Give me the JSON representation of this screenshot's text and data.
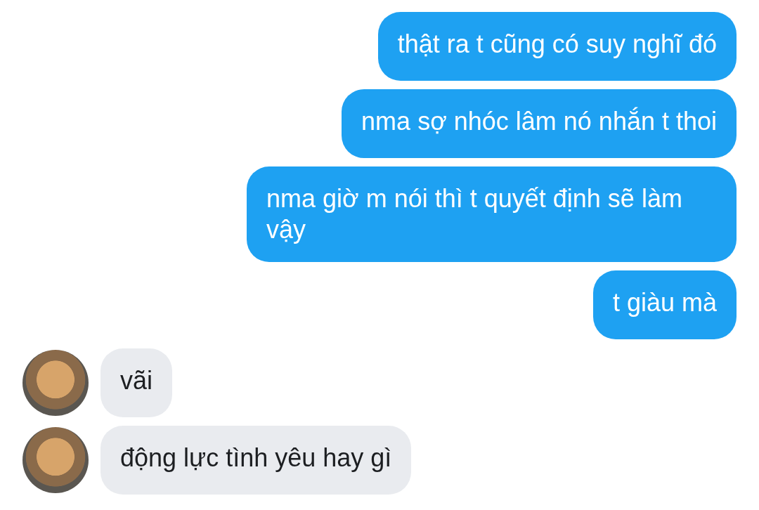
{
  "messages": [
    {
      "kind": "sent",
      "text": "thật ra t cũng có suy nghĩ đó"
    },
    {
      "kind": "sent",
      "text": "nma sợ nhóc lâm nó nhắn t thoi"
    },
    {
      "kind": "sent",
      "text": "nma giờ m nói thì t quyết định sẽ làm vậy"
    },
    {
      "kind": "sent",
      "text": "t giàu mà"
    },
    {
      "kind": "received",
      "text": "vãi"
    },
    {
      "kind": "received",
      "text": "động lực tình yêu hay gì"
    }
  ]
}
